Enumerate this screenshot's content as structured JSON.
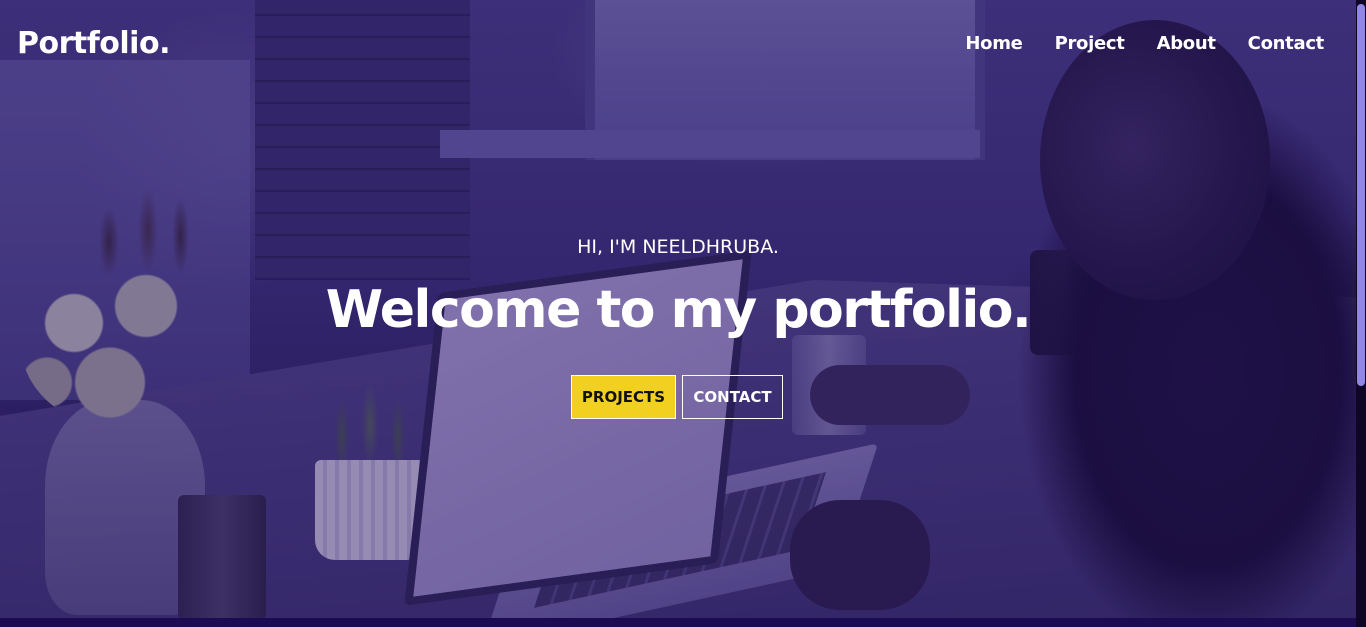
{
  "navbar": {
    "logo": "Portfolio.",
    "links": [
      {
        "label": "Home"
      },
      {
        "label": "Project"
      },
      {
        "label": "About"
      },
      {
        "label": "Contact"
      }
    ]
  },
  "hero": {
    "intro": "HI, I'M NEELDHRUBA.",
    "headline": "Welcome to my portfolio.",
    "buttons": {
      "projects_label": "PROJECTS",
      "contact_label": "CONTACT"
    }
  },
  "colors": {
    "accent_yellow": "#f2d01f",
    "overlay_purple": "#2a1464",
    "scrollbar_thumb": "#8f86e6"
  }
}
